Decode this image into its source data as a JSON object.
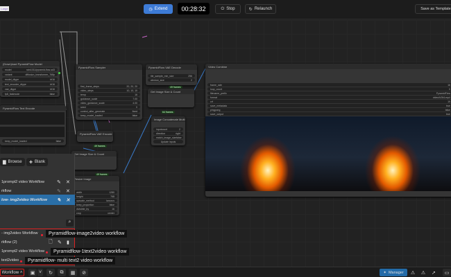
{
  "topbar": {
    "badge": "Large",
    "extend": "Extend",
    "timer": "00:28:32",
    "stop": "Stop",
    "relaunch": "Relaunch",
    "save_template": "Save as Template"
  },
  "nodes": {
    "download": {
      "title": "(Down)load PyramidFlow Model",
      "widgets": [
        [
          "model",
          "rain1011/pyramid-flow-sd3"
        ],
        [
          "variant",
          "diffusion_transformer_768p"
        ],
        [
          "model_dtype",
          "bf16"
        ],
        [
          "text_encoder_dtype",
          "bf16"
        ],
        [
          "vae_dtype",
          "bf16"
        ],
        [
          "fp8_fastmode",
          "false"
        ]
      ]
    },
    "textencode": {
      "title": "PyramidFlow Text Encode",
      "keep": "keep_model_loaded",
      "keep_val": "false"
    },
    "sampler": {
      "title": "PyramidFlow Sampler",
      "widgets": [
        [
          "first_frame_steps",
          "20, 20, 20"
        ],
        [
          "video_steps",
          "10, 10, 10"
        ],
        [
          "temp",
          "16"
        ],
        [
          "guidance_scale",
          "7.00"
        ],
        [
          "video_guidance_scale",
          "4.00"
        ],
        [
          "seed",
          "0"
        ],
        [
          "control_after_generate",
          "fixed"
        ],
        [
          "keep_model_loaded",
          "false"
        ]
      ]
    },
    "vaedecode": {
      "title": "PyramidFlow VAE Decode",
      "widgets": [
        [
          "tile_sample_min_size",
          "256"
        ],
        [
          "window_size",
          "2"
        ]
      ]
    },
    "getsize": {
      "title": "Get Image Size & Count"
    },
    "concat": {
      "title": "Image Concatenate Multi",
      "widgets": [
        [
          "inputcount",
          "2"
        ],
        [
          "direction",
          "right"
        ],
        [
          "match_image_size",
          "false"
        ]
      ],
      "update": "Update inputs"
    },
    "vaeencode": {
      "title": "PyramidFlow VAE Encode"
    },
    "getsize2": {
      "title": "Get Image Size & Count"
    },
    "loadimage": {
      "title": "Resize Image",
      "widgets": [
        [
          "width",
          "1280"
        ],
        [
          "height",
          "768"
        ],
        [
          "upscale_method",
          "lanczos"
        ],
        [
          "keep_proportion",
          "false"
        ],
        [
          "divisible_by",
          "16"
        ],
        [
          "crop",
          "center"
        ]
      ]
    },
    "video": {
      "title": "Video Combine",
      "widgets": [
        [
          "frame_rate",
          "16"
        ],
        [
          "loop_count",
          "0"
        ],
        [
          "filename_prefix",
          "PyramidFlow"
        ],
        [
          "format",
          "video/h264-mp4"
        ],
        [
          "crf",
          "19"
        ],
        [
          "save_metadata",
          "true"
        ],
        [
          "pingpong",
          "false"
        ],
        [
          "save_output",
          "true"
        ]
      ]
    }
  },
  "tags": [
    "49 frames",
    "64 frames",
    "49 frames",
    "49 frames"
  ],
  "panel": {
    "browse": "Browse",
    "blank": "Blank",
    "open": [
      "1prompt2 video Workflow",
      "rkflow",
      "low- img2video Workflow"
    ],
    "saved": [
      "- img2video Workflow",
      "rkflow (2)",
      "1prompt2 video Workflow",
      "text2video"
    ]
  },
  "tooltips": [
    "Pyramidflow-image2video workflow",
    "Pyramidflow-1text2video workflow",
    "Pyramidflow- multi text2 video workflow"
  ],
  "bottombar": {
    "workflow": "Workflow",
    "manager": "Manager"
  }
}
